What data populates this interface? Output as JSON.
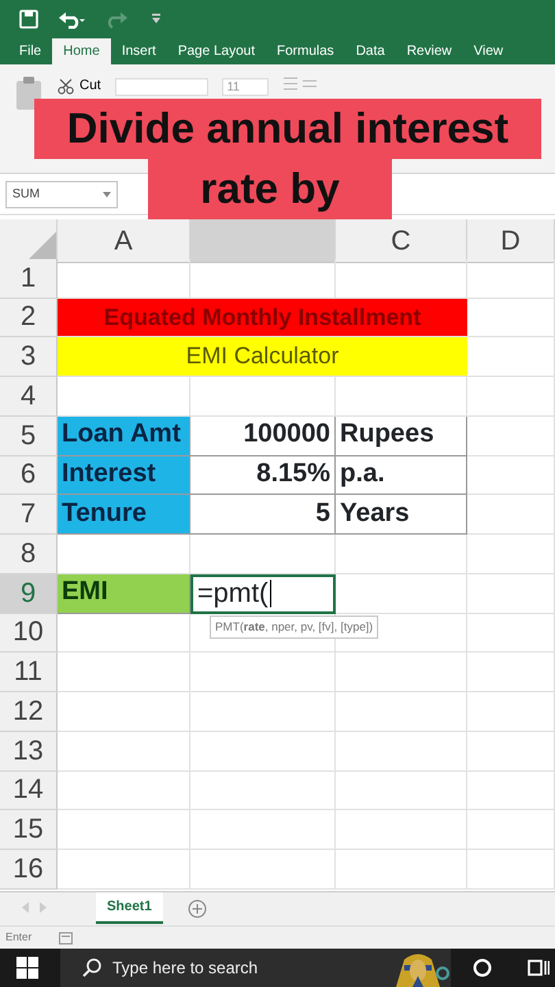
{
  "ribbon_tabs": [
    {
      "label": "File",
      "selected": false
    },
    {
      "label": "Home",
      "selected": true
    },
    {
      "label": "Insert",
      "selected": false
    },
    {
      "label": "Page Layout",
      "selected": false
    },
    {
      "label": "Formulas",
      "selected": false
    },
    {
      "label": "Data",
      "selected": false
    },
    {
      "label": "Review",
      "selected": false
    },
    {
      "label": "View",
      "selected": false
    }
  ],
  "ribbon": {
    "cut_label": "Cut",
    "font_size": "11"
  },
  "caption_lines": [
    "Divide annual interest",
    "rate by"
  ],
  "name_box": "SUM",
  "column_headers": {
    "a": "A",
    "c": "C",
    "d": "D"
  },
  "rows": [
    {
      "number": "1",
      "selected": false,
      "kind": "empty"
    },
    {
      "number": "2",
      "selected": false,
      "kind": "merged",
      "text": "Equated Monthly Installment",
      "color": "#ff0000"
    },
    {
      "number": "3",
      "selected": false,
      "kind": "merged",
      "text": "EMI Calculator",
      "color": "#ffff00"
    },
    {
      "number": "4",
      "selected": false,
      "kind": "empty"
    },
    {
      "number": "5",
      "selected": false,
      "kind": "cells",
      "a": {
        "text": "Loan Amt",
        "kind": "label",
        "color": "#1fb4e6"
      },
      "b": {
        "text": "100000",
        "kind": "number"
      },
      "c": {
        "text": "Rupees",
        "kind": "label"
      }
    },
    {
      "number": "6",
      "selected": false,
      "kind": "cells",
      "a": {
        "text": "Interest",
        "kind": "label",
        "color": "#1fb4e6"
      },
      "b": {
        "text": "8.15%",
        "kind": "number"
      },
      "c": {
        "text": "p.a.",
        "kind": "label"
      }
    },
    {
      "number": "7",
      "selected": false,
      "kind": "cells",
      "a": {
        "text": "Tenure",
        "kind": "label",
        "color": "#1fb4e6"
      },
      "b": {
        "text": "5",
        "kind": "number"
      },
      "c": {
        "text": "Years",
        "kind": "label"
      }
    },
    {
      "number": "8",
      "selected": false,
      "kind": "empty"
    },
    {
      "number": "9",
      "selected": true,
      "kind": "cells",
      "a": {
        "text": "EMI",
        "kind": "label",
        "color": "#92d050"
      },
      "b": {
        "text": "=pmt(",
        "kind": "editing"
      }
    },
    {
      "number": "10",
      "selected": false,
      "kind": "empty"
    },
    {
      "number": "11",
      "selected": false,
      "kind": "empty"
    },
    {
      "number": "12",
      "selected": false,
      "kind": "empty"
    },
    {
      "number": "13",
      "selected": false,
      "kind": "empty"
    },
    {
      "number": "14",
      "selected": false,
      "kind": "empty"
    },
    {
      "number": "15",
      "selected": false,
      "kind": "empty"
    },
    {
      "number": "16",
      "selected": false,
      "kind": "empty"
    }
  ],
  "function_tooltip": "PMT(**rate**, nper, pv, [fv], [type])",
  "sheet_tabs": [
    {
      "label": "Sheet1",
      "selected": true
    }
  ],
  "status_bar": {
    "mode": "Enter"
  },
  "taskbar": {
    "search_placeholder": "Type here to search"
  }
}
